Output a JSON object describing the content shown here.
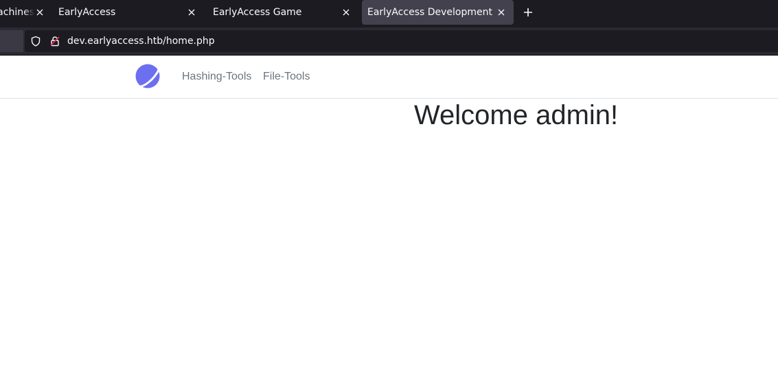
{
  "browser": {
    "tabs": [
      {
        "title": "Machines",
        "active": false
      },
      {
        "title": "EarlyAccess",
        "active": false
      },
      {
        "title": "EarlyAccess Game",
        "active": false
      },
      {
        "title": "EarlyAccess Development",
        "active": true
      }
    ],
    "new_tab_icon": "plus-icon",
    "url": "dev.earlyaccess.htb/home.php",
    "colors": {
      "tabstrip_bg": "#1c1b22",
      "active_tab_bg": "#42414d",
      "toolbar_bg": "#2b2a33",
      "lock_accent": "#e22850"
    }
  },
  "page": {
    "nav": {
      "logo_icon": "planet-logo-icon",
      "links": [
        {
          "label": "Hashing-Tools"
        },
        {
          "label": "File-Tools"
        }
      ]
    },
    "heading": "Welcome admin!",
    "colors": {
      "logo": "#6c6ff0",
      "link": "#6c757d",
      "heading": "#212529"
    }
  }
}
